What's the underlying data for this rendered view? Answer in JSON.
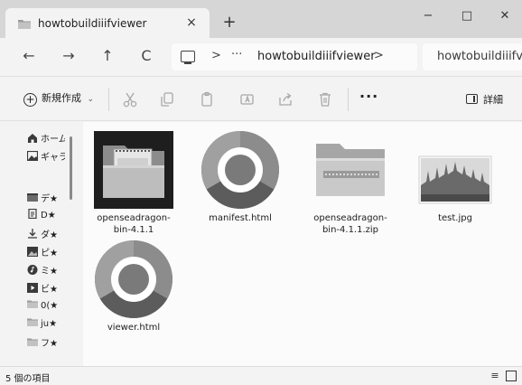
{
  "tab": {
    "title": "howtobuildiiifviewer",
    "close": "×",
    "new_tab": "+"
  },
  "window_controls": {
    "minimize": "−",
    "maximize": "□",
    "close": "✕"
  },
  "nav": {
    "back": "←",
    "forward": "→",
    "up": "↑",
    "refresh": "C"
  },
  "address": {
    "separator": ">",
    "overflow": "···",
    "current": "howtobuildiiifviewer",
    "separator2": ">"
  },
  "search": {
    "value": "howtobuildiiifvie"
  },
  "commands": {
    "new_label": "新規作成",
    "new_caret": "⌄",
    "more": "···",
    "details": "詳細"
  },
  "sidebar": {
    "items": [
      {
        "label": "ホーム",
        "icon": "home-icon"
      },
      {
        "label": "ギャラリー",
        "icon": "gallery-icon"
      },
      {
        "label": "デ★",
        "icon": "desktop-icon"
      },
      {
        "label": "D★",
        "icon": "document-icon"
      },
      {
        "label": "ダ★",
        "icon": "download-icon"
      },
      {
        "label": "ピ★",
        "icon": "picture-icon"
      },
      {
        "label": "ミ★",
        "icon": "music-icon"
      },
      {
        "label": "ビ★",
        "icon": "video-icon"
      },
      {
        "label": "0(★",
        "icon": "folder-icon"
      },
      {
        "label": "ju★",
        "icon": "folder-icon"
      },
      {
        "label": "フ★",
        "icon": "folder-icon"
      }
    ]
  },
  "files": [
    {
      "name": "openseadragon-bin-4.1.1",
      "type": "folder"
    },
    {
      "name": "manifest.html",
      "type": "html"
    },
    {
      "name": "openseadragon-bin-4.1.1.zip",
      "type": "zip"
    },
    {
      "name": "test.jpg",
      "type": "image"
    },
    {
      "name": "viewer.html",
      "type": "html"
    }
  ],
  "status": {
    "count": "5 個の項目"
  }
}
